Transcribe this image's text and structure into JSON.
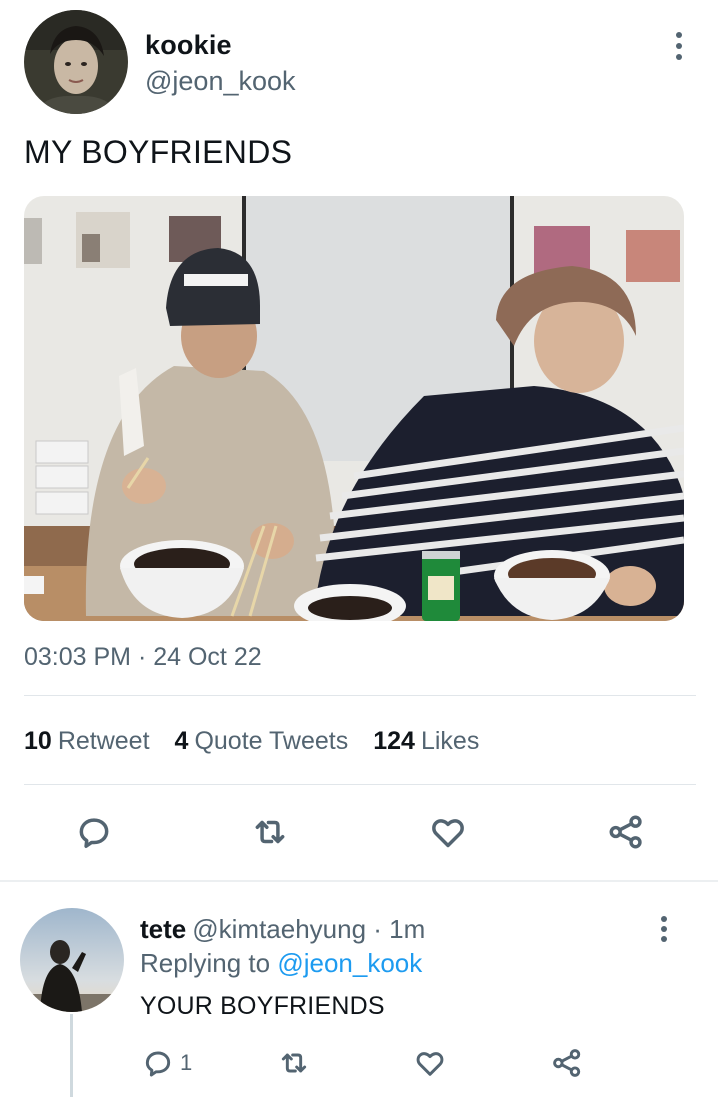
{
  "tweet": {
    "author": {
      "display_name": "kookie",
      "handle": "@jeon_kook"
    },
    "text": "MY BOYFRIENDS",
    "timestamp": "03:03 PM · 24 Oct 22",
    "stats": {
      "retweets_count": "10",
      "retweets_label": "Retweet",
      "quotes_count": "4",
      "quotes_label": "Quote Tweets",
      "likes_count": "124",
      "likes_label": "Likes"
    },
    "actions": [
      "reply-icon",
      "retweet-icon",
      "like-icon",
      "share-icon"
    ]
  },
  "reply": {
    "display_name": "tete",
    "handle_time": "@kimtaehyung · 1m",
    "replying_prefix": "Replying to",
    "replying_handle": "@jeon_kook",
    "text": "YOUR BOYFRIENDS",
    "reply_count": "1",
    "actions": [
      "reply-icon",
      "retweet-icon",
      "like-icon",
      "share-icon"
    ]
  },
  "colors": {
    "text_primary": "#0f1419",
    "text_secondary": "#536471",
    "link": "#1d9bf0",
    "divider": "#e1e6ea"
  }
}
